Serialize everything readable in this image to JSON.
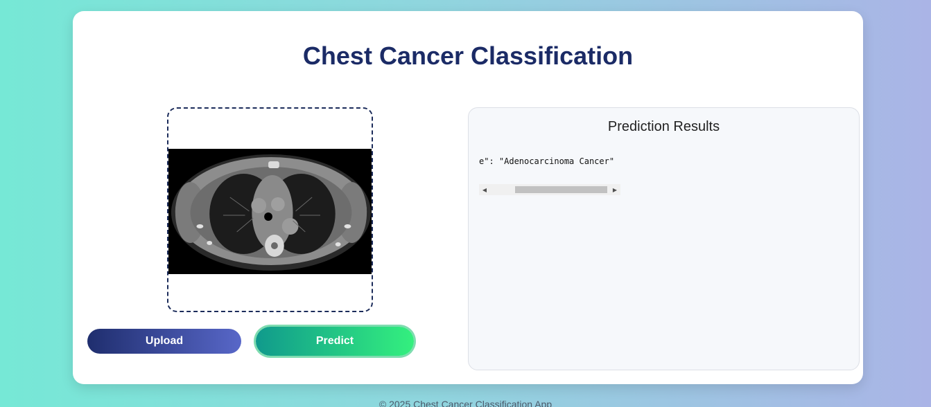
{
  "app": {
    "title": "Chest Cancer Classification"
  },
  "actions": {
    "upload_label": "Upload",
    "predict_label": "Predict"
  },
  "results": {
    "title": "Prediction Results",
    "visible_text": "e\": \"Adenocarcinoma Cancer\""
  },
  "footer": {
    "text": "© 2025 Chest Cancer Classification App"
  },
  "colors": {
    "title": "#1b2b66",
    "upload_gradient": [
      "#1f2e6e",
      "#5867c8"
    ],
    "predict_gradient": [
      "#109a8c",
      "#34f07e"
    ]
  },
  "icons": {
    "scroll_left": "scroll-left-arrow-icon",
    "scroll_right": "scroll-right-arrow-icon"
  }
}
